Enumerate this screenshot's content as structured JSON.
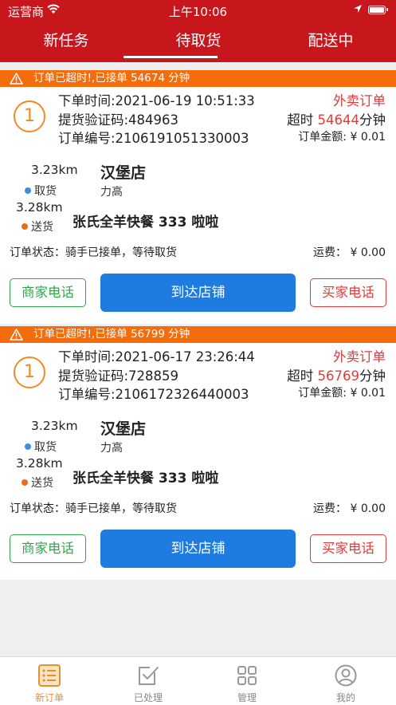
{
  "status_bar": {
    "carrier": "运营商",
    "time": "上午10:06"
  },
  "tabs": [
    {
      "label": "新任务",
      "active": false
    },
    {
      "label": "待取货",
      "active": true
    },
    {
      "label": "配送中",
      "active": false
    }
  ],
  "colors": {
    "header_bg": "#c8161d",
    "warning_bg": "#f56c0c",
    "primary_button": "#1e7be0",
    "merchant_green": "#2ea84a",
    "buyer_red": "#e23a3a",
    "order_number_orange": "#f08a24",
    "active_nav": "#e8902a"
  },
  "orders": [
    {
      "warning": "订单已超时!,已接单 54674 分钟",
      "index": "1",
      "order_time": "下单时间:2021-06-19 10:51:33",
      "pickup_code": "提货验证码:484963",
      "order_no": "订单编号:2106191051330003",
      "type": "外卖订单",
      "overtime_prefix": "超时 ",
      "overtime_value": "54644",
      "overtime_suffix": "分钟",
      "amount": "订单金额: ¥ 0.01",
      "pickup_distance": "3.23km",
      "pickup_label": "取货",
      "delivery_distance": "3.28km",
      "delivery_label": "送货",
      "shop_name": "汉堡店",
      "shop_address": "力高",
      "customer": "张氏全羊快餐 333 啦啦",
      "status": "订单状态：骑手已接单，等待取货",
      "fee": "运费：  ¥ 0.00",
      "merchant_call": "商家电话",
      "arrive": "到达店铺",
      "buyer_call": "买家电话"
    },
    {
      "warning": "订单已超时!,已接单 56799 分钟",
      "index": "1",
      "order_time": "下单时间:2021-06-17 23:26:44",
      "pickup_code": "提货验证码:728859",
      "order_no": "订单编号:2106172326440003",
      "type": "外卖订单",
      "overtime_prefix": "超时 ",
      "overtime_value": "56769",
      "overtime_suffix": "分钟",
      "amount": "订单金额: ¥ 0.01",
      "pickup_distance": "3.23km",
      "pickup_label": "取货",
      "delivery_distance": "3.28km",
      "delivery_label": "送货",
      "shop_name": "汉堡店",
      "shop_address": "力高",
      "customer": "张氏全羊快餐 333 啦啦",
      "status": "订单状态：骑手已接单，等待取货",
      "fee": "运费：  ¥ 0.00",
      "merchant_call": "商家电话",
      "arrive": "到达店铺",
      "buyer_call": "买家电话"
    }
  ],
  "bottom_nav": [
    {
      "label": "新订单",
      "icon": "list-icon",
      "active": true
    },
    {
      "label": "已处理",
      "icon": "checked-box-icon",
      "active": false
    },
    {
      "label": "管理",
      "icon": "grid-icon",
      "active": false
    },
    {
      "label": "我的",
      "icon": "user-icon",
      "active": false
    }
  ]
}
